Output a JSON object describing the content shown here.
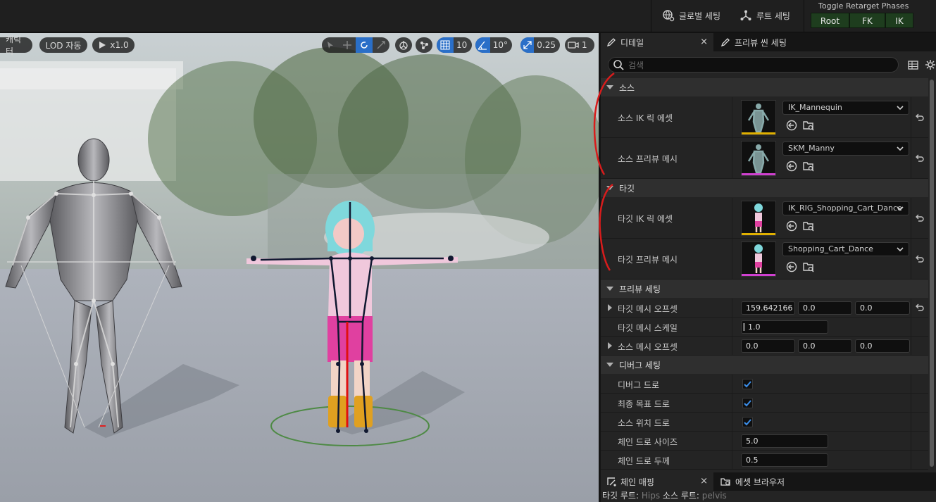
{
  "toolbar": {
    "global_settings_label": "글로벌 세팅",
    "root_settings_label": "루트 세팅",
    "phases_title": "Toggle Retarget Phases",
    "phase_root": "Root",
    "phase_fk": "FK",
    "phase_ik": "IK",
    "phase_on_color": "#1e3d1e"
  },
  "viewport": {
    "character_label": "캐릭터",
    "lod_label": "LOD 자동",
    "play_speed": "x1.0",
    "grid_size": "10",
    "rotation_snap": "10°",
    "scale_snap": "0.25",
    "camera_speed": "1",
    "accent": "#2a6fc8"
  },
  "panel": {
    "details_tab": "디테일",
    "close_symbol": "×",
    "preview_scene_tab": "프리뷰 씬 세팅",
    "search_placeholder": "검색",
    "source_category": "소스",
    "source_ik_rig_label": "소스 IK 릭 에셋",
    "source_ik_rig_value": "IK_Mannequin",
    "source_preview_mesh_label": "소스 프리뷰 메시",
    "source_preview_mesh_value": "SKM_Manny",
    "target_category": "타깃",
    "target_ik_rig_label": "타깃 IK 릭 에셋",
    "target_ik_rig_value": "IK_RIG_Shopping_Cart_Dance",
    "target_preview_mesh_label": "타깃 프리뷰 메시",
    "target_preview_mesh_value": "Shopping_Cart_Dance",
    "preview_category": "프리뷰 세팅",
    "target_mesh_offset_label": "타깃 메시 오프셋",
    "target_mesh_offset": [
      "159.642166",
      "0.0",
      "0.0"
    ],
    "target_mesh_scale_label": "타깃 메시 스케일",
    "target_mesh_scale": "1.0",
    "source_mesh_offset_label": "소스 메시 오프셋",
    "source_mesh_offset": [
      "0.0",
      "0.0",
      "0.0"
    ],
    "debug_category": "디버그 세팅",
    "debug_draw_label": "디버그 드로",
    "debug_draw": true,
    "final_goal_draw_label": "최종 목표 드로",
    "final_goal_draw": true,
    "source_location_draw_label": "소스 위치 드로",
    "source_location_draw": true,
    "chain_draw_size_label": "체인 드로 사이즈",
    "chain_draw_size": "5.0",
    "chain_draw_thickness_label": "체인 드로 두께",
    "chain_draw_thickness": "0.5",
    "ik_rig_asset_color": "#e0b000",
    "mesh_asset_color": "#d040d0",
    "checkbox_color": "#3b8eea"
  },
  "bottom": {
    "chain_mapping_tab": "체인 매핑",
    "asset_browser_tab": "에셋 브라우저",
    "target_root_key": "타깃 루트:",
    "target_root_value": "Hips",
    "source_root_key": "소스 루트:",
    "source_root_value": "pelvis"
  }
}
